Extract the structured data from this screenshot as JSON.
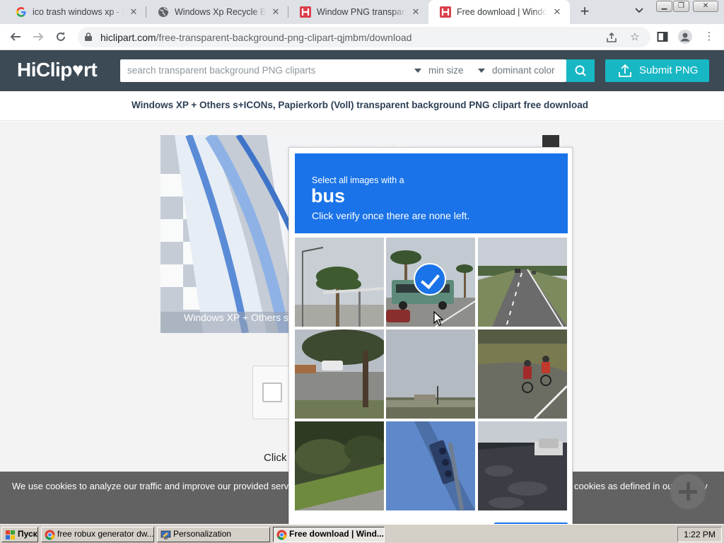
{
  "browser": {
    "tabs": [
      {
        "title": "ico trash windows xp - Go",
        "icon": "google-icon"
      },
      {
        "title": "Windows Xp Recycle Bin I",
        "icon": "globe-icon"
      },
      {
        "title": "Window PNG transparent",
        "icon": "hiclipart-icon"
      },
      {
        "title": "Free download | Window",
        "icon": "hiclipart-icon",
        "active": true
      }
    ],
    "url_host": "hiclipart.com",
    "url_path": "/free-transparent-background-png-clipart-qjmbm/download"
  },
  "site": {
    "logo": "HiClip♥rt",
    "search_placeholder": "search transparent background PNG cliparts",
    "filter_size": "min size",
    "filter_color": "dominant color",
    "submit_label": "Submit PNG",
    "page_title": "Windows XP + Others s+ICONs, Papierkorb (Voll) transparent background PNG clipart free download",
    "preview_caption": "Windows XP + Others s+I",
    "preview_top_caption": "Clipart dimensions: 256×256",
    "click_text": "Click",
    "accent": "#17b7c4",
    "header_bg": "#3c4a55"
  },
  "captcha": {
    "instruction_line1": "Select all images with a",
    "target": "bus",
    "instruction_line2": "Click verify once there are none left.",
    "accent": "#1a73e8",
    "tiles": [
      {
        "scene": "palm trees and street light",
        "selected": false
      },
      {
        "scene": "bus with palm trees",
        "selected": true
      },
      {
        "scene": "road with cars",
        "selected": false
      },
      {
        "scene": "street intersection with tree",
        "selected": false
      },
      {
        "scene": "empty sky and parking lot",
        "selected": false
      },
      {
        "scene": "cyclists on road",
        "selected": false
      },
      {
        "scene": "shrubs and curb",
        "selected": false
      },
      {
        "scene": "traffic light",
        "selected": false
      },
      {
        "scene": "shaded street with cars",
        "selected": false
      }
    ]
  },
  "cookie": {
    "text_left": "We use cookies to analyze our traffic and improve our provided serv",
    "text_right": "cookies as defined in our privacy"
  },
  "taskbar": {
    "start_label": "Пуск",
    "items": [
      {
        "label": "free robux generator dw..."
      },
      {
        "label": "Personalization"
      },
      {
        "label": "Free download | Wind...",
        "active": true
      }
    ],
    "clock": "1:22 PM"
  }
}
